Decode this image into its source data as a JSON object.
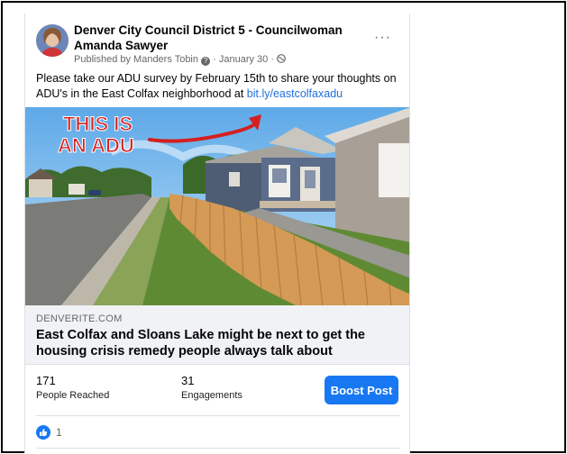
{
  "post": {
    "page_name": "Denver City Council District 5 - Councilwoman Amanda Sawyer",
    "byline_prefix": "Published by Manders Tobin",
    "byline_date": "January 30",
    "more_label": "···",
    "text": "Please take our ADU survey by February 15th to share your thoughts on ADU's in the East Colfax neighborhood at ",
    "link_text": "bit.ly/eastcolfaxadu",
    "image_caption_line1": "THIS IS",
    "image_caption_line2": "AN ADU"
  },
  "link_preview": {
    "domain": "DENVERITE.COM",
    "headline": "East Colfax and Sloans Lake might be next to get the housing crisis remedy people always talk about"
  },
  "stats": {
    "reached_value": "171",
    "reached_label": "People Reached",
    "engagements_value": "31",
    "engagements_label": "Engagements",
    "boost_label": "Boost Post"
  },
  "reactions": {
    "count": "1",
    "icon": "thumbs-up-icon"
  },
  "colors": {
    "accent": "#1877f2",
    "link": "#216fdb",
    "caption_red": "#d42020"
  }
}
